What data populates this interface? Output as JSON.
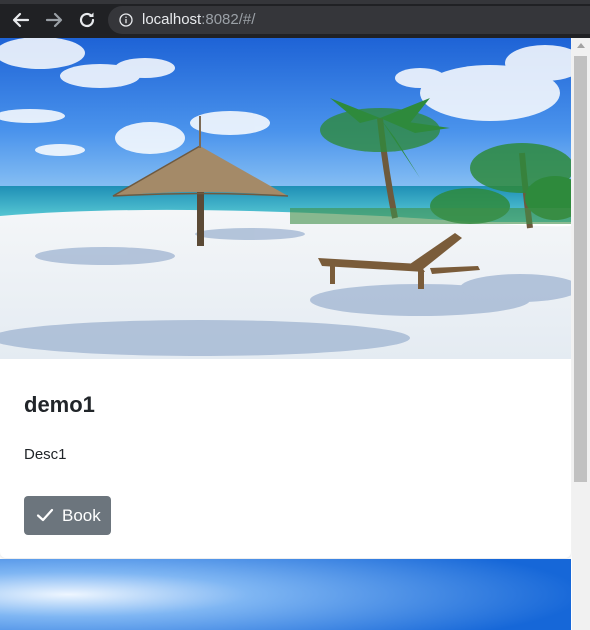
{
  "browser": {
    "url_host": "localhost",
    "url_rest": ":8082/#/",
    "icons": [
      "back-icon",
      "forward-icon",
      "reload-icon",
      "info-icon"
    ]
  },
  "card": {
    "title": "demo1",
    "description": "Desc1",
    "button_label": "Book",
    "button_icon": "check-icon",
    "button_color": "#6c757d"
  },
  "colors": {
    "toolbar_bg": "#202124",
    "omnibox_bg": "#35363a",
    "page_bg": "#ffffff"
  }
}
